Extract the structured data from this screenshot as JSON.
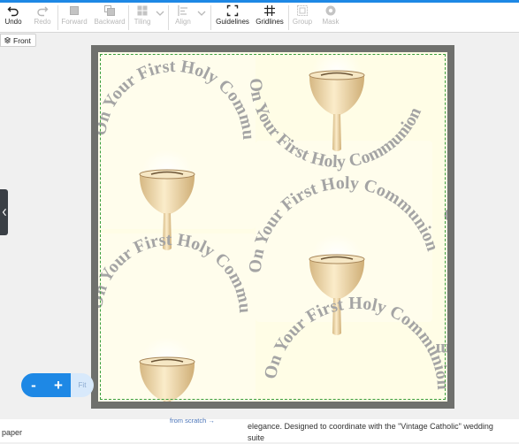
{
  "toolbar": {
    "undo": "Undo",
    "redo": "Redo",
    "forward": "Forward",
    "backward": "Backward",
    "tiling": "Tiling",
    "align": "Align",
    "guidelines": "Guidelines",
    "gridlines": "Gridlines",
    "group": "Group",
    "mask": "Mask"
  },
  "view": {
    "side": "Front"
  },
  "design": {
    "repeat_text": "On Your First Holy Communion",
    "colors": {
      "background": "#fffde6",
      "text": "#a4a4a4",
      "guideline": "#3b9e3b",
      "frame": "#6f706d"
    }
  },
  "zoom": {
    "minus": "-",
    "plus": "+",
    "fit": "Fit"
  },
  "footer": {
    "left_text": "paper",
    "link_text": "from scratch →",
    "description": "elegance. Designed to coordinate with the \"Vintage Catholic\" wedding suite"
  },
  "accent": "#1e88e5"
}
